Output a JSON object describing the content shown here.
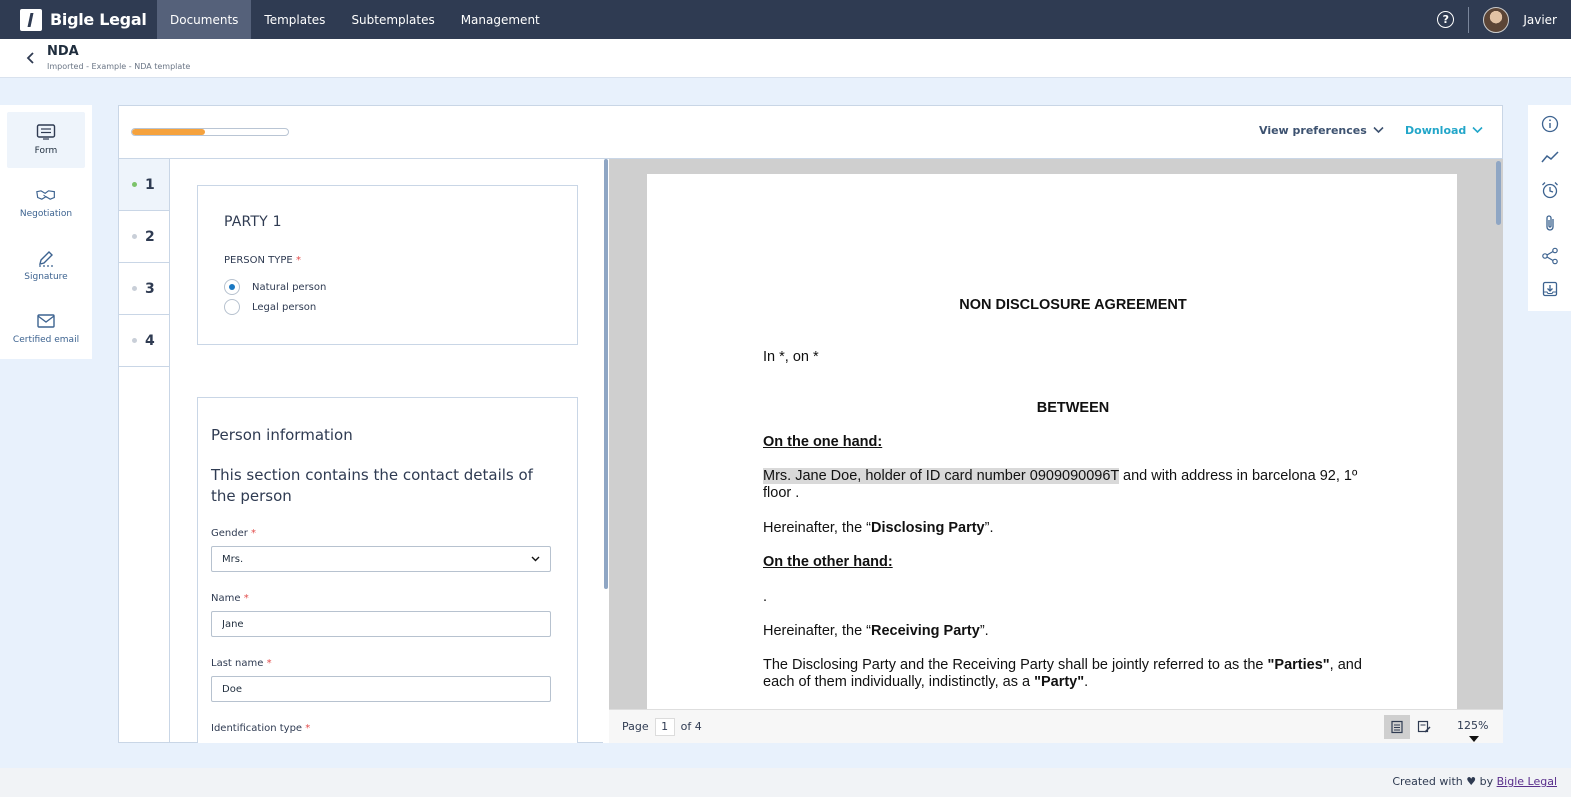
{
  "app": {
    "brand": "Bigle Legal"
  },
  "nav": {
    "items": [
      "Documents",
      "Templates",
      "Subtemplates",
      "Management"
    ],
    "active": "Documents"
  },
  "user": {
    "name": "Javier"
  },
  "header": {
    "title": "NDA",
    "subtitle": "Imported - Example - NDA template"
  },
  "left_rail": [
    {
      "label": "Form",
      "icon": "form-icon"
    },
    {
      "label": "Negotiation",
      "icon": "handshake-icon"
    },
    {
      "label": "Signature",
      "icon": "pen-icon"
    },
    {
      "label": "Certified email",
      "icon": "envelope-icon"
    }
  ],
  "right_rail": [
    "info-icon",
    "trend-icon",
    "alarm-icon",
    "paperclip-icon",
    "share-icon",
    "download-tray-icon"
  ],
  "toolbar": {
    "progress": 0.47,
    "view_preferences": "View preferences",
    "download": "Download"
  },
  "steps": [
    "1",
    "2",
    "3",
    "4"
  ],
  "party_card": {
    "title": "PARTY 1",
    "person_type_label": "PERSON TYPE",
    "options": [
      "Natural person",
      "Legal person"
    ],
    "selected": "Natural person"
  },
  "person_card": {
    "title": "Person information",
    "description": "This section contains the contact details of the person",
    "gender_label": "Gender",
    "gender_value": "Mrs.",
    "name_label": "Name",
    "name_value": "Jane",
    "last_name_label": "Last name",
    "last_name_value": "Doe",
    "id_type_label": "Identification type"
  },
  "document": {
    "title": "NON DISCLOSURE AGREEMENT",
    "place_date": "In *, on *",
    "between": "BETWEEN",
    "one_hand": "On the one hand:",
    "party1_highlight": "Mrs. Jane Doe, holder of ID card number 0909090096T",
    "party1_rest": " and with address in barcelona 92, 1º floor .",
    "hereinafter_prefix": "Hereinafter, the “",
    "disclosing": "Disclosing Party",
    "hereinafter_suffix": "”.",
    "other_hand": "On the other hand:",
    "party2": ".",
    "receiving": "Receiving Party",
    "parties_text_1": "The Disclosing Party and the Receiving Party shall be jointly referred to as the ",
    "parties_bold": "\"Parties\"",
    "parties_text_2": ", and each of them individually, indistinctly, as a ",
    "party_bold": "\"Party\"",
    "parties_text_3": "."
  },
  "viewer": {
    "page_label": "Page",
    "page": "1",
    "of_label": "of 4",
    "zoom": "125%"
  },
  "footer": {
    "created_with": "Created with",
    "heart": "♥",
    "by": "by",
    "link": "Bigle Legal"
  }
}
